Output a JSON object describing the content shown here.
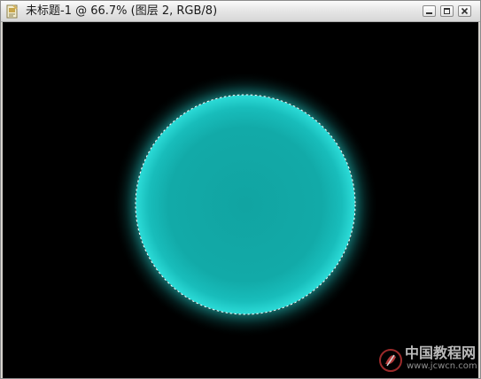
{
  "window": {
    "title": "未标题-1 @ 66.7% (图层 2, RGB/8)",
    "doc_icon": "document-icon",
    "buttons": {
      "minimize_icon": "minimize-icon",
      "maximize_icon": "maximize-icon",
      "close_icon": "close-icon"
    }
  },
  "canvas": {
    "background_color": "#000000",
    "circle_fill_color": "#12aaa8",
    "circle_glow_color": "#2fe3df",
    "selection": "circular-marquee-selection"
  },
  "watermark": {
    "title": "中国教程网",
    "url": "www.jcwcn.com",
    "logo_icon": "jcwcn-logo-icon"
  }
}
